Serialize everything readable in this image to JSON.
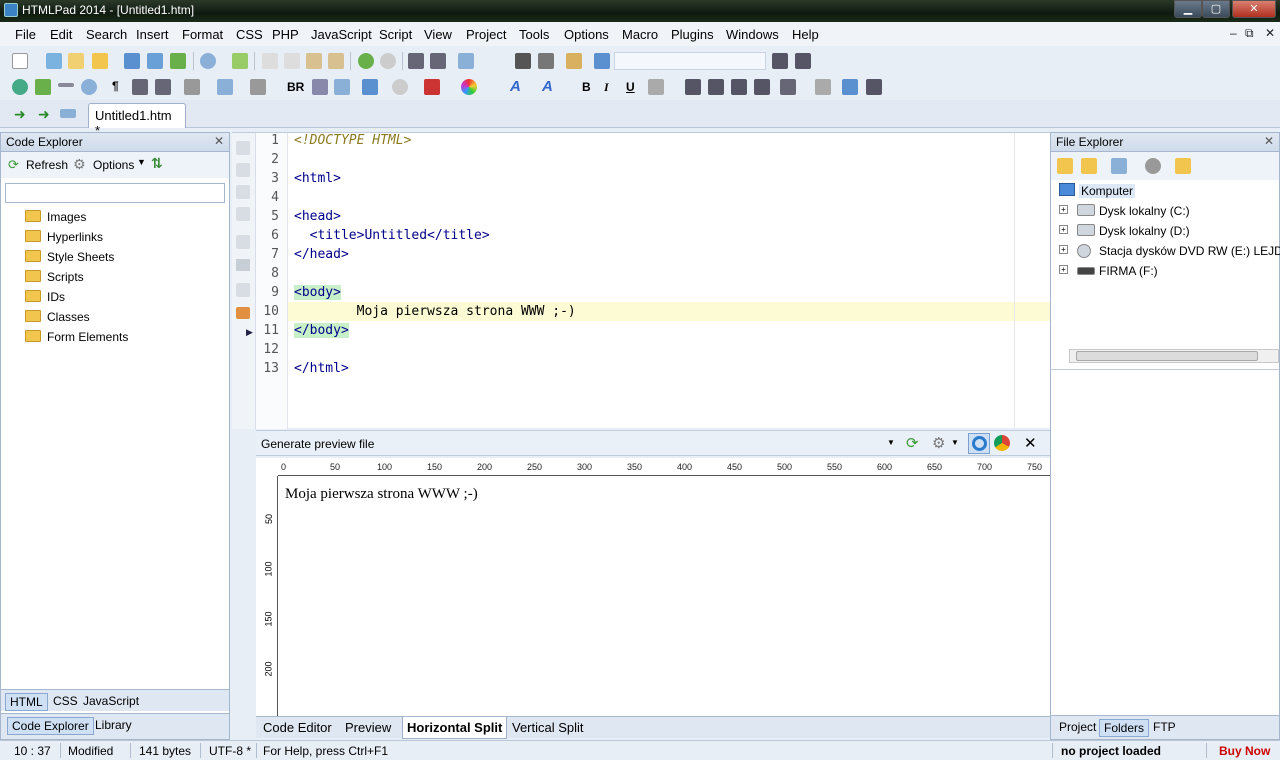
{
  "window": {
    "title": "HTMLPad 2014 - [Untitled1.htm]",
    "min_symbol": "▁",
    "max_symbol": "▢",
    "close_symbol": "✕"
  },
  "menu": [
    "File",
    "Edit",
    "Search",
    "Insert",
    "Format",
    "CSS",
    "PHP",
    "JavaScript",
    "Script",
    "View",
    "Project",
    "Tools",
    "Options",
    "Macro",
    "Plugins",
    "Windows",
    "Help"
  ],
  "mdi_controls": [
    "–",
    "⧉",
    "✕"
  ],
  "toolbar2": {
    "br_label": "BR",
    "bold": "B",
    "italic": "I",
    "underline": "U"
  },
  "document_tab": "Untitled1.htm *",
  "code_explorer": {
    "title": "Code Explorer",
    "refresh_label": "Refresh",
    "options_label": "Options",
    "items": [
      "Images",
      "Hyperlinks",
      "Style Sheets",
      "Scripts",
      "IDs",
      "Classes",
      "Form Elements"
    ],
    "lang_tabs": [
      "HTML",
      "CSS",
      "JavaScript"
    ],
    "panel_tabs": [
      "Code Explorer",
      "Library"
    ]
  },
  "editor": {
    "line_numbers": [
      "1",
      "2",
      "3",
      "4",
      "5",
      "6",
      "7",
      "8",
      "9",
      "10",
      "11",
      "12",
      "13"
    ],
    "lines": [
      "<!DOCTYPE HTML>",
      "",
      "<html>",
      "",
      "<head>",
      "  <title>Untitled</title>",
      "</head>",
      "",
      "<body>",
      "        Moja pierwsza strona WWW ;-)",
      "</body>",
      "",
      "</html>"
    ]
  },
  "preview": {
    "dropdown_label": "Generate preview file",
    "ruler_top": [
      "0",
      "50",
      "100",
      "150",
      "200",
      "250",
      "300",
      "350",
      "400",
      "450",
      "500",
      "550",
      "600",
      "650",
      "700",
      "750"
    ],
    "ruler_left": [
      "50",
      "100",
      "150",
      "200"
    ],
    "content": "Moja pierwsza strona WWW ;-)"
  },
  "view_tabs": [
    "Code Editor",
    "Preview",
    "Horizontal Split",
    "Vertical Split"
  ],
  "file_explorer": {
    "title": "File Explorer",
    "root": "Komputer",
    "drives": [
      "Dysk lokalny (C:)",
      "Dysk lokalny (D:)",
      "Stacja dysków DVD RW (E:) LEJDIS",
      "FIRMA (F:)"
    ],
    "tabs": [
      "Project",
      "Folders",
      "FTP"
    ]
  },
  "status": {
    "position": "10 : 37",
    "state": "Modified",
    "size": "141 bytes",
    "encoding": "UTF-8 *",
    "help": "For Help, press Ctrl+F1",
    "project": "no project loaded",
    "buy": "Buy Now"
  },
  "colors": {
    "buy_now": "#cc0000",
    "highlight_line": "#fdfbd4",
    "body_tag_bg": "#c8f0c8"
  }
}
